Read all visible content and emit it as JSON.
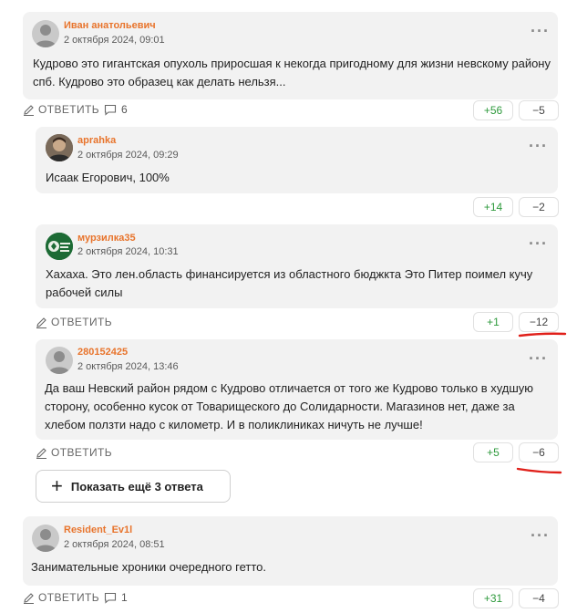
{
  "comments": [
    {
      "author": "Иван анатольевич",
      "date": "2 октября 2024, 09:01",
      "text": "Кудрово это гигантская опухоль приросшая к некогда пригодному для жизни невскому району спб. Кудрово это образец как делать нельзя...",
      "reply_label": "ОТВЕТИТЬ",
      "replies_count": "6",
      "up": "+56",
      "down": "−5",
      "avatar": "default-avatar"
    },
    {
      "author": "aprahka",
      "date": "2 октября 2024, 09:29",
      "text": "Исаак Егорович, 100%",
      "up": "+14",
      "down": "−2",
      "avatar": "photo-avatar"
    },
    {
      "author": "мурзилка35",
      "date": "2 октября 2024, 10:31",
      "text": "Хахаха. Это лен.область финансируется из областного бюджкта Это Питер поимел кучу рабочей силы",
      "reply_label": "ОТВЕТИТЬ",
      "up": "+1",
      "down": "−12",
      "avatar": "green-logo-avatar"
    },
    {
      "author": "280152425",
      "date": "2 октября 2024, 13:46",
      "text": "Да ваш Невский район рядом с Кудрово отличается от того же Кудрово только в худшую сторону, особенно кусок от Товарищеского до Солидарности. Магазинов нет, даже за хлебом ползти надо с километр. И в поликлиниках ничуть не лучше!",
      "reply_label": "ОТВЕТИТЬ",
      "up": "+5",
      "down": "−6",
      "avatar": "default-avatar"
    },
    {
      "author": "Resident_Ev1l",
      "date": "2 октября 2024, 08:51",
      "text": "Занимательные хроники очередного гетто.",
      "reply_label": "ОТВЕТИТЬ",
      "replies_count": "1",
      "up": "+31",
      "down": "−4",
      "avatar": "default-avatar"
    }
  ],
  "show_more_label": "Показать ещё 3 ответа",
  "colors": {
    "author": "#e8742c",
    "upvote": "#2e9a3c",
    "card_bg": "#f2f2f2",
    "annotation": "#e0201a"
  }
}
